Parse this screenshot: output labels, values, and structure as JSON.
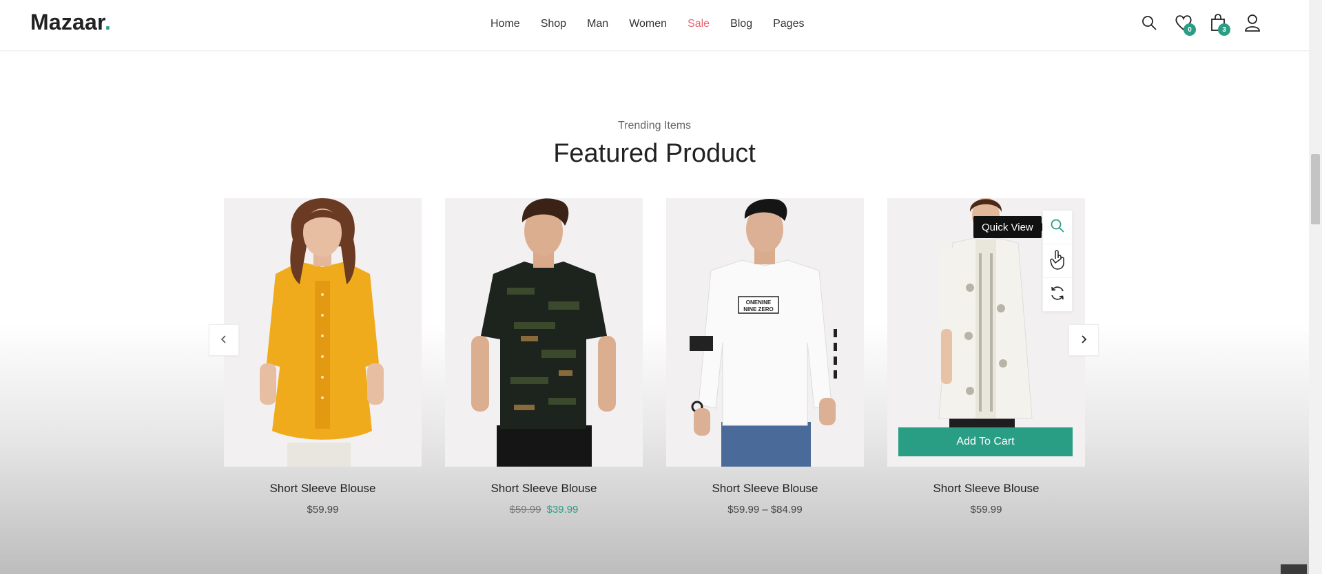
{
  "header": {
    "logo": "Mazaar",
    "logo_dot": ".",
    "nav": [
      "Home",
      "Shop",
      "Man",
      "Women",
      "Sale",
      "Blog",
      "Pages"
    ],
    "wishlist_count": "0",
    "cart_count": "3"
  },
  "section": {
    "subtitle": "Trending Items",
    "title": "Featured Product"
  },
  "products": [
    {
      "name": "Short Sleeve Blouse",
      "price": "$59.99",
      "old_price": "",
      "sale_price": ""
    },
    {
      "name": "Short Sleeve Blouse",
      "price": "",
      "old_price": "$59.99",
      "sale_price": "$39.99"
    },
    {
      "name": "Short Sleeve Blouse",
      "price": "$59.99 – $84.99",
      "old_price": "",
      "sale_price": ""
    },
    {
      "name": "Short Sleeve Blouse",
      "price": "$59.99",
      "old_price": "",
      "sale_price": ""
    }
  ],
  "hover": {
    "tooltip": "Quick View",
    "add_to_cart": "Add To Cart"
  },
  "colors": {
    "accent": "#2a9d85",
    "sale": "#e9636b"
  },
  "tshirt_print": [
    "ONENINE",
    "NINE ZERO"
  ]
}
